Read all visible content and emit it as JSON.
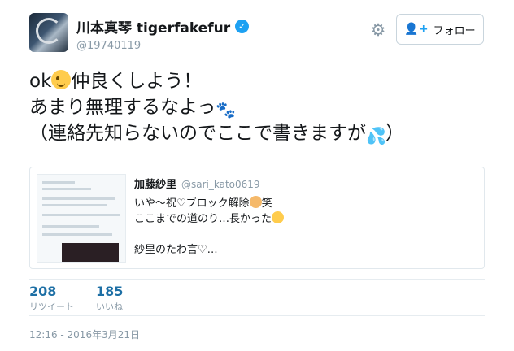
{
  "author": {
    "display_name": "川本真琴 tigerfakefur",
    "handle": "@19740119",
    "verified": true,
    "verified_icon": "check-icon"
  },
  "actions": {
    "settings_icon": "gear-icon",
    "follow_label": "フォロー",
    "follow_icon": "add-user-icon"
  },
  "tweet": {
    "line1_a": "ok",
    "line1_b": "仲良くしよう！",
    "line2_a": "あまり無理するなよっ",
    "line3_a": "（連絡先知らないのでここで書きますが",
    "line3_b": "）",
    "emojis": [
      "winking-face",
      "paw-prints",
      "sweat-droplets"
    ]
  },
  "quoted": {
    "name": "加藤紗里",
    "handle": "@sari_kato0619",
    "line1_a": "いや〜祝♡ブロック解除",
    "line1_b": "笑",
    "line2_a": "ここまでの道のり…長かった",
    "line4": "紗里のたわ言♡…",
    "emojis": [
      "woman-raising-hand",
      "thinking-face"
    ]
  },
  "stats": {
    "retweets_value": "208",
    "retweets_label": "リツイート",
    "likes_value": "185",
    "likes_label": "いいね"
  },
  "timestamp": "12:16 - 2016年3月21日",
  "colors": {
    "accent": "#1da1f2",
    "stat_value": "#1d6fa5",
    "muted": "#8899a6"
  }
}
